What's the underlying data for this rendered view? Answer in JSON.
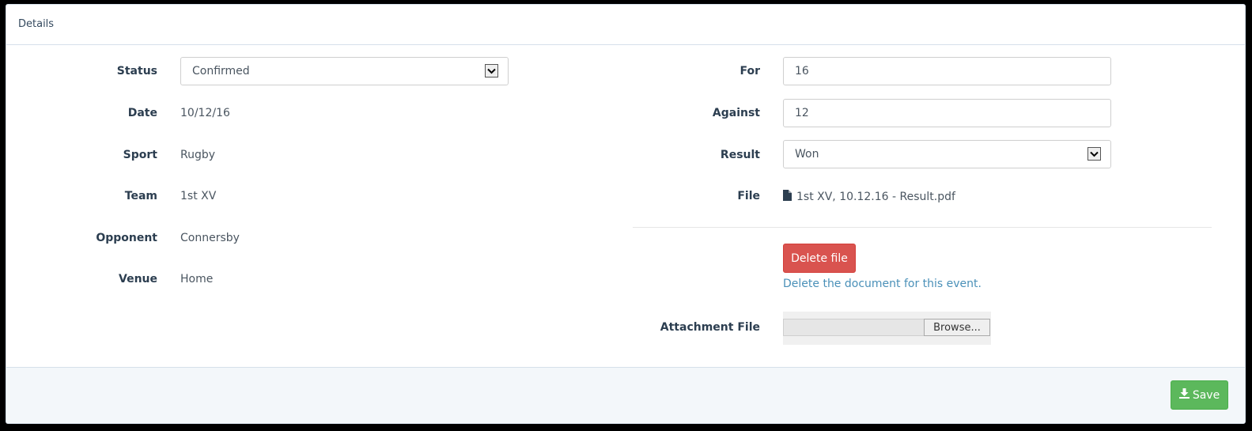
{
  "panel": {
    "title": "Details"
  },
  "left": {
    "status": {
      "label": "Status",
      "value": "Confirmed"
    },
    "date": {
      "label": "Date",
      "value": "10/12/16"
    },
    "sport": {
      "label": "Sport",
      "value": "Rugby"
    },
    "team": {
      "label": "Team",
      "value": "1st XV"
    },
    "opponent": {
      "label": "Opponent",
      "value": "Connersby"
    },
    "venue": {
      "label": "Venue",
      "value": "Home"
    }
  },
  "right": {
    "for": {
      "label": "For",
      "value": "16"
    },
    "against": {
      "label": "Against",
      "value": "12"
    },
    "result": {
      "label": "Result",
      "value": "Won"
    },
    "file": {
      "label": "File",
      "name": "1st XV, 10.12.16 - Result.pdf",
      "icon": "file-icon"
    },
    "delete_button": "Delete file",
    "delete_help": "Delete the document for this event.",
    "attachment": {
      "label": "Attachment File",
      "browse_label": "Browse..."
    }
  },
  "footer": {
    "save_label": "Save",
    "save_icon": "download-icon"
  }
}
